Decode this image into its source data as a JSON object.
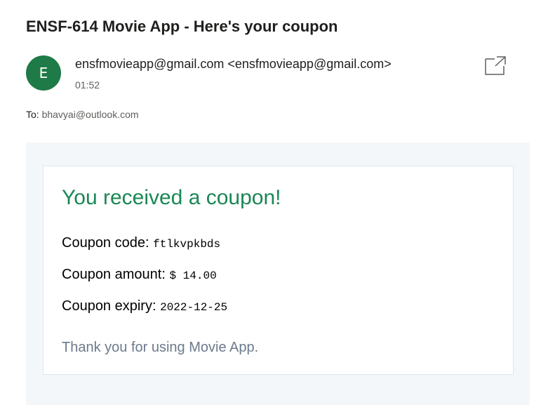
{
  "email": {
    "subject": "ENSF-614 Movie App - Here's your coupon",
    "avatar_initial": "E",
    "sender": "ensfmovieapp@gmail.com <ensfmovieapp@gmail.com>",
    "time": "01:52",
    "to_label": "To:",
    "recipient": "bhavyai@outlook.com",
    "popout_icon": "popout-icon"
  },
  "body": {
    "title": "You received a coupon!",
    "code_label": "Coupon code:",
    "code_value": "ftlkvpkbds",
    "amount_label": "Coupon amount:",
    "amount_value": "$ 14.00",
    "expiry_label": "Coupon expiry:",
    "expiry_value": "2022-12-25",
    "thanks": "Thank you for using Movie App."
  },
  "colors": {
    "avatar_bg": "#1e7a46",
    "title_green": "#1a8754",
    "thanks_gray": "#6c7a8c",
    "body_bg": "#f4f7fa"
  }
}
